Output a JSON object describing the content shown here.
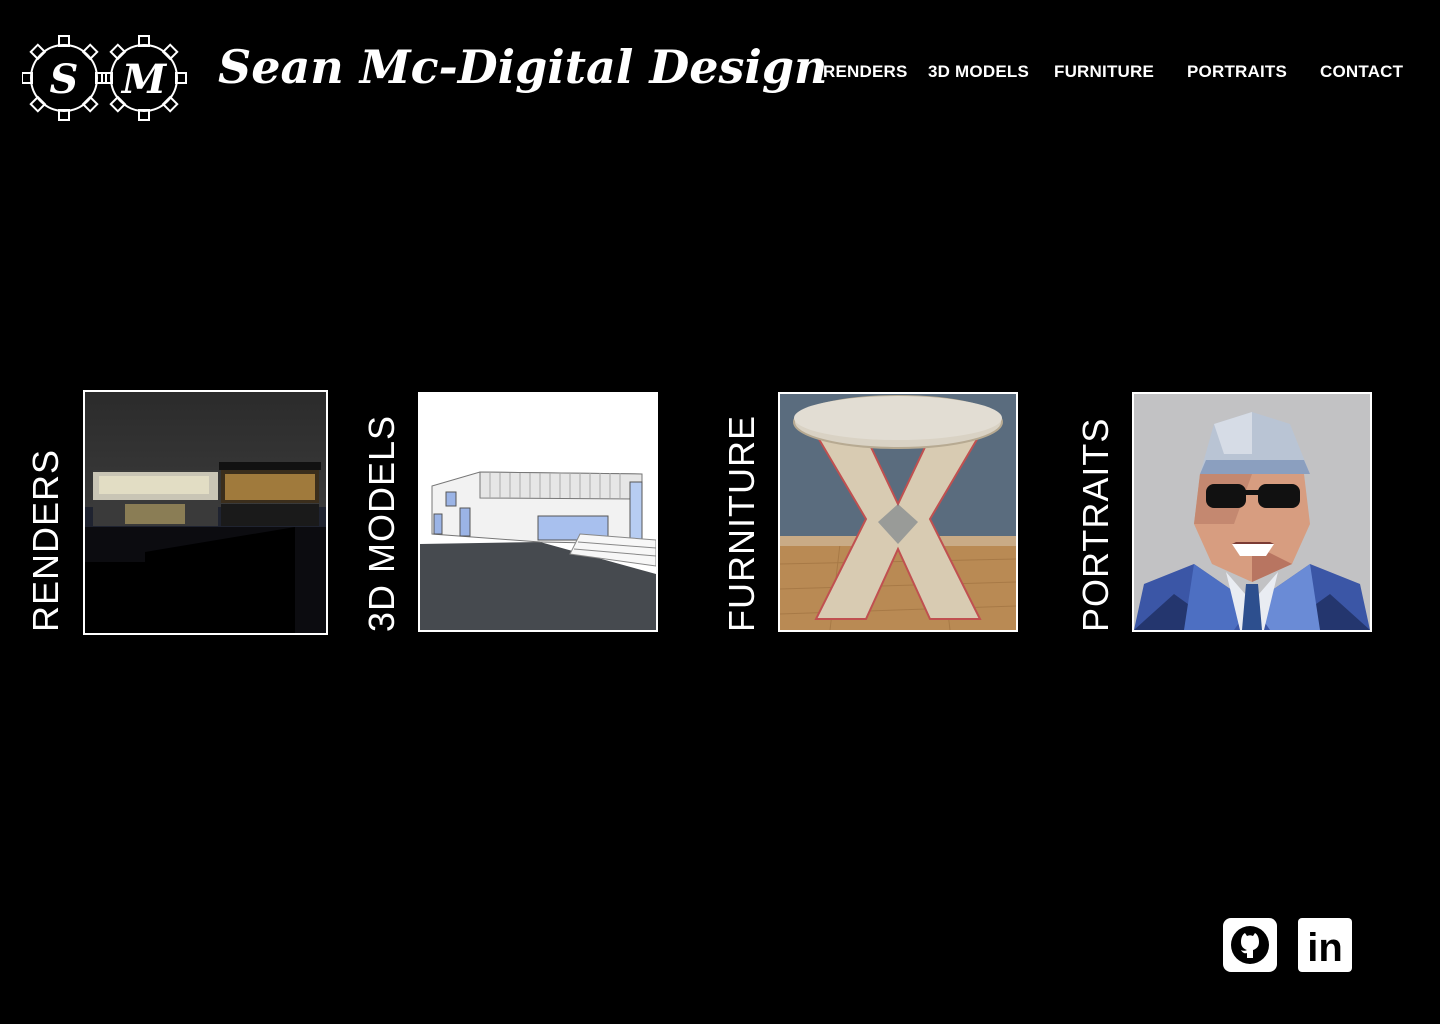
{
  "header": {
    "logo": {
      "letters": [
        "S",
        "M"
      ],
      "icon": "gear-monogram-logo"
    },
    "title": "Sean Mc-Digital Design"
  },
  "nav": {
    "items": [
      {
        "label": "RENDERS"
      },
      {
        "label": "3D MODELS"
      },
      {
        "label": "FURNITURE"
      },
      {
        "label": "PORTRAITS"
      },
      {
        "label": "CONTACT"
      }
    ]
  },
  "gallery": {
    "cards": [
      {
        "label": "RENDERS",
        "image": "building-section-render-image"
      },
      {
        "label": "3D MODELS",
        "image": "house-3d-model-image"
      },
      {
        "label": "FURNITURE",
        "image": "plywood-stool-image"
      },
      {
        "label": "PORTRAITS",
        "image": "low-poly-portrait-image"
      }
    ]
  },
  "social": {
    "github_icon": "github-icon",
    "linkedin_icon": "linkedin-icon",
    "linkedin_text": "in"
  },
  "colors": {
    "background": "#000000",
    "foreground": "#ffffff"
  }
}
